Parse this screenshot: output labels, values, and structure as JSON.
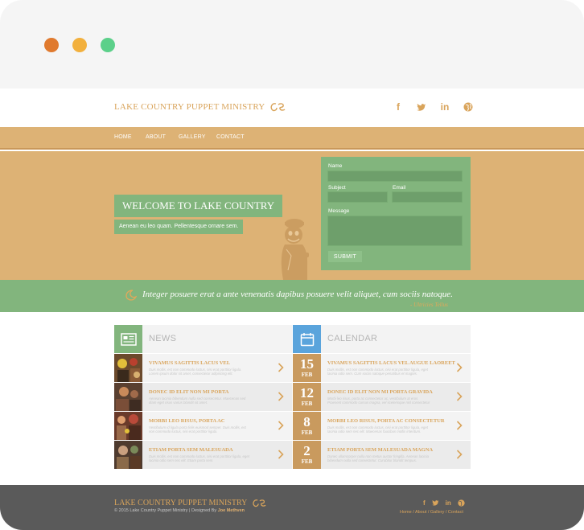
{
  "colors": {
    "accent_gold": "#d9a45b",
    "hero_tan": "#ddb275",
    "accent_green": "#82b57d",
    "calendar_blue": "#5aa4dc",
    "footer_gray": "#5a5a5a"
  },
  "browser": {
    "buttons": [
      "close",
      "minimize",
      "maximize"
    ]
  },
  "header": {
    "logo_text": "LAKE COUNTRY PUPPET MINISTRY",
    "social_icons": [
      "facebook-icon",
      "twitter-icon",
      "linkedin-icon",
      "globe-icon"
    ]
  },
  "nav": {
    "items": [
      "HOME",
      "ABOUT",
      "GALLERY",
      "CONTACT"
    ]
  },
  "hero": {
    "welcome": "WELCOME TO LAKE COUNTRY",
    "subtext": "Aenean eu leo quam. Pellentesque ornare sem."
  },
  "contact_form": {
    "name_label": "Name",
    "subject_label": "Subject",
    "email_label": "Email",
    "message_label": "Message",
    "submit_label": "SUBMIT"
  },
  "quote": {
    "text": "Integer posuere erat a ante venenatis dapibus posuere velit aliquet, cum sociis natoque.",
    "author": "- Ultricies Tellus"
  },
  "news": {
    "title": "NEWS",
    "items": [
      {
        "title": "VIVAMUS SAGITTIS LACUS VEL",
        "body": "Duis mollis, est non commodo luctus, nisi erat porttitor ligula. Lorem ipsum dolor sit amet, consectetur adipiscing elit."
      },
      {
        "title": "DONEC ID ELIT NON MI PORTA",
        "body": "Aenean lacinia bibendum nulla sed consectetur. Maecenas sed diam eget risus varius blandit sit amet."
      },
      {
        "title": "MORBI LEO RISUS, PORTA AC",
        "body": "Vestibulum id ligula porta felis euismod semper. Duis mollis, est non commodo luctus, nisi erat porttitor ligula."
      },
      {
        "title": "ETIAM PORTA SEM MALESUADA",
        "body": "Duis mollis, est non commodo luctus, nisi erat porttitor ligula, eget lacinia odio sem nec elit. Etiam porta sem."
      }
    ]
  },
  "calendar": {
    "title": "CALENDAR",
    "items": [
      {
        "day": "15",
        "month": "FEB",
        "title": "VIVAMUS SAGITTIS LACUS VEL AUGUE LAOREET",
        "body": "Duis mollis, est non commodo luctus, nisi erat porttitor ligula, eget lacinia odio sem. Cum sociis natoque penatibus et magnis."
      },
      {
        "day": "12",
        "month": "FEB",
        "title": "DONEC ID ELIT NON MI PORTA GRAVIDA",
        "body": "Morbi leo risus, porta ac consectetur ac, vestibulum at eros. Praesent commodo cursus magna, vel scelerisque nisl consectetur et."
      },
      {
        "day": "8",
        "month": "FEB",
        "title": "MORBI LEO RISUS, PORTA AC CONSECTETUR",
        "body": "Duis mollis, est non commodo luctus, nisi erat porttitor ligula, eget lacinia odio sem nec elit. Maecenas faucibus mollis interdum."
      },
      {
        "day": "2",
        "month": "FEB",
        "title": "ETIAM PORTA SEM MALESUADA MAGNA",
        "body": "Donec ullamcorper nulla non metus auctor fringilla. Aenean lacinia bibendum nulla sed consectetur. Curabitur blandit tempus."
      }
    ]
  },
  "footer": {
    "logo_text": "LAKE COUNTRY PUPPET MINISTRY",
    "copyright": "© 2015 Lake Country Puppet Ministry  |  Designed By ",
    "designer": "Joe Methven",
    "links": "Home / About / Gallery / Contact"
  }
}
